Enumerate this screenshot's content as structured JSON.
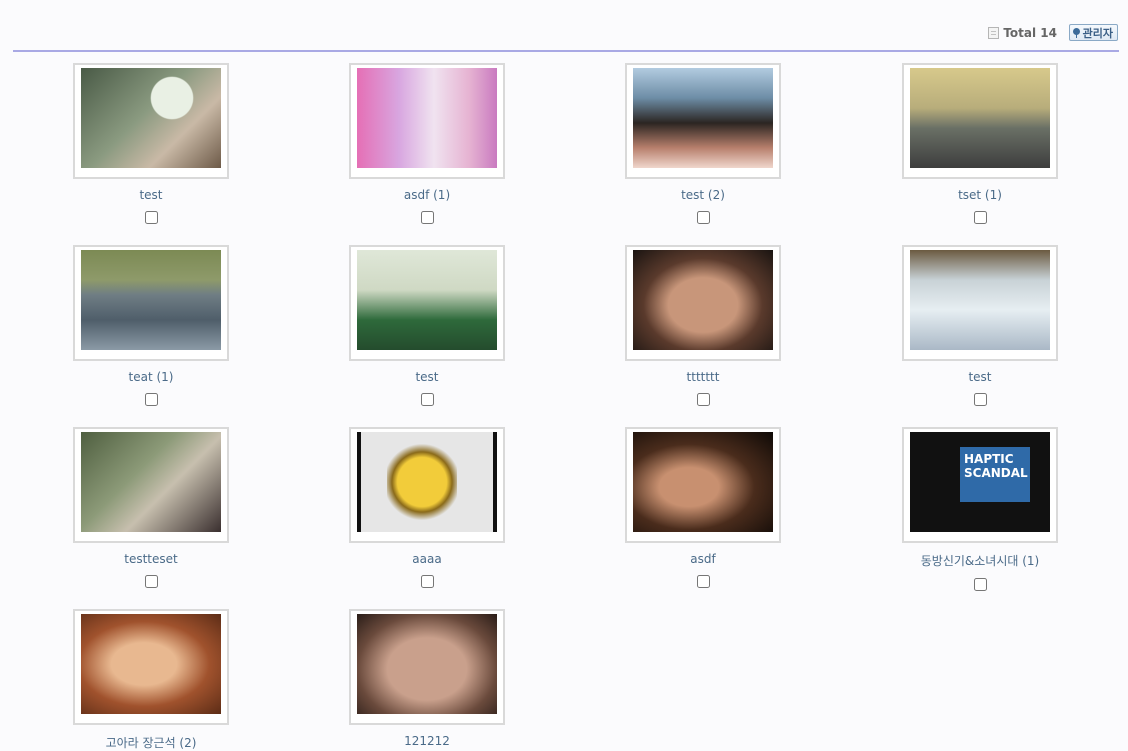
{
  "header": {
    "total_label": "Total 14",
    "admin_label": "관리자"
  },
  "colors": {
    "rule": "#a9a9e4",
    "caption": "#4a6a88",
    "thumb_border": "#d9d9d9"
  },
  "items": [
    {
      "caption": "test",
      "icon": "photo-thumbnail"
    },
    {
      "caption": "asdf (1)",
      "icon": "photo-thumbnail"
    },
    {
      "caption": "test (2)",
      "icon": "photo-thumbnail"
    },
    {
      "caption": "tset (1)",
      "icon": "photo-thumbnail"
    },
    {
      "caption": "teat (1)",
      "icon": "photo-thumbnail"
    },
    {
      "caption": "test",
      "icon": "photo-thumbnail"
    },
    {
      "caption": "ttttttt",
      "icon": "photo-thumbnail"
    },
    {
      "caption": "test",
      "icon": "photo-thumbnail"
    },
    {
      "caption": "testteset",
      "icon": "photo-thumbnail"
    },
    {
      "caption": "aaaa",
      "icon": "photo-thumbnail"
    },
    {
      "caption": "asdf",
      "icon": "photo-thumbnail"
    },
    {
      "caption": "동방신기&소녀시대 (1)",
      "icon": "photo-thumbnail"
    },
    {
      "caption": "고아라 장근석 (2)",
      "icon": "photo-thumbnail"
    },
    {
      "caption": "121212",
      "icon": "photo-thumbnail"
    }
  ]
}
